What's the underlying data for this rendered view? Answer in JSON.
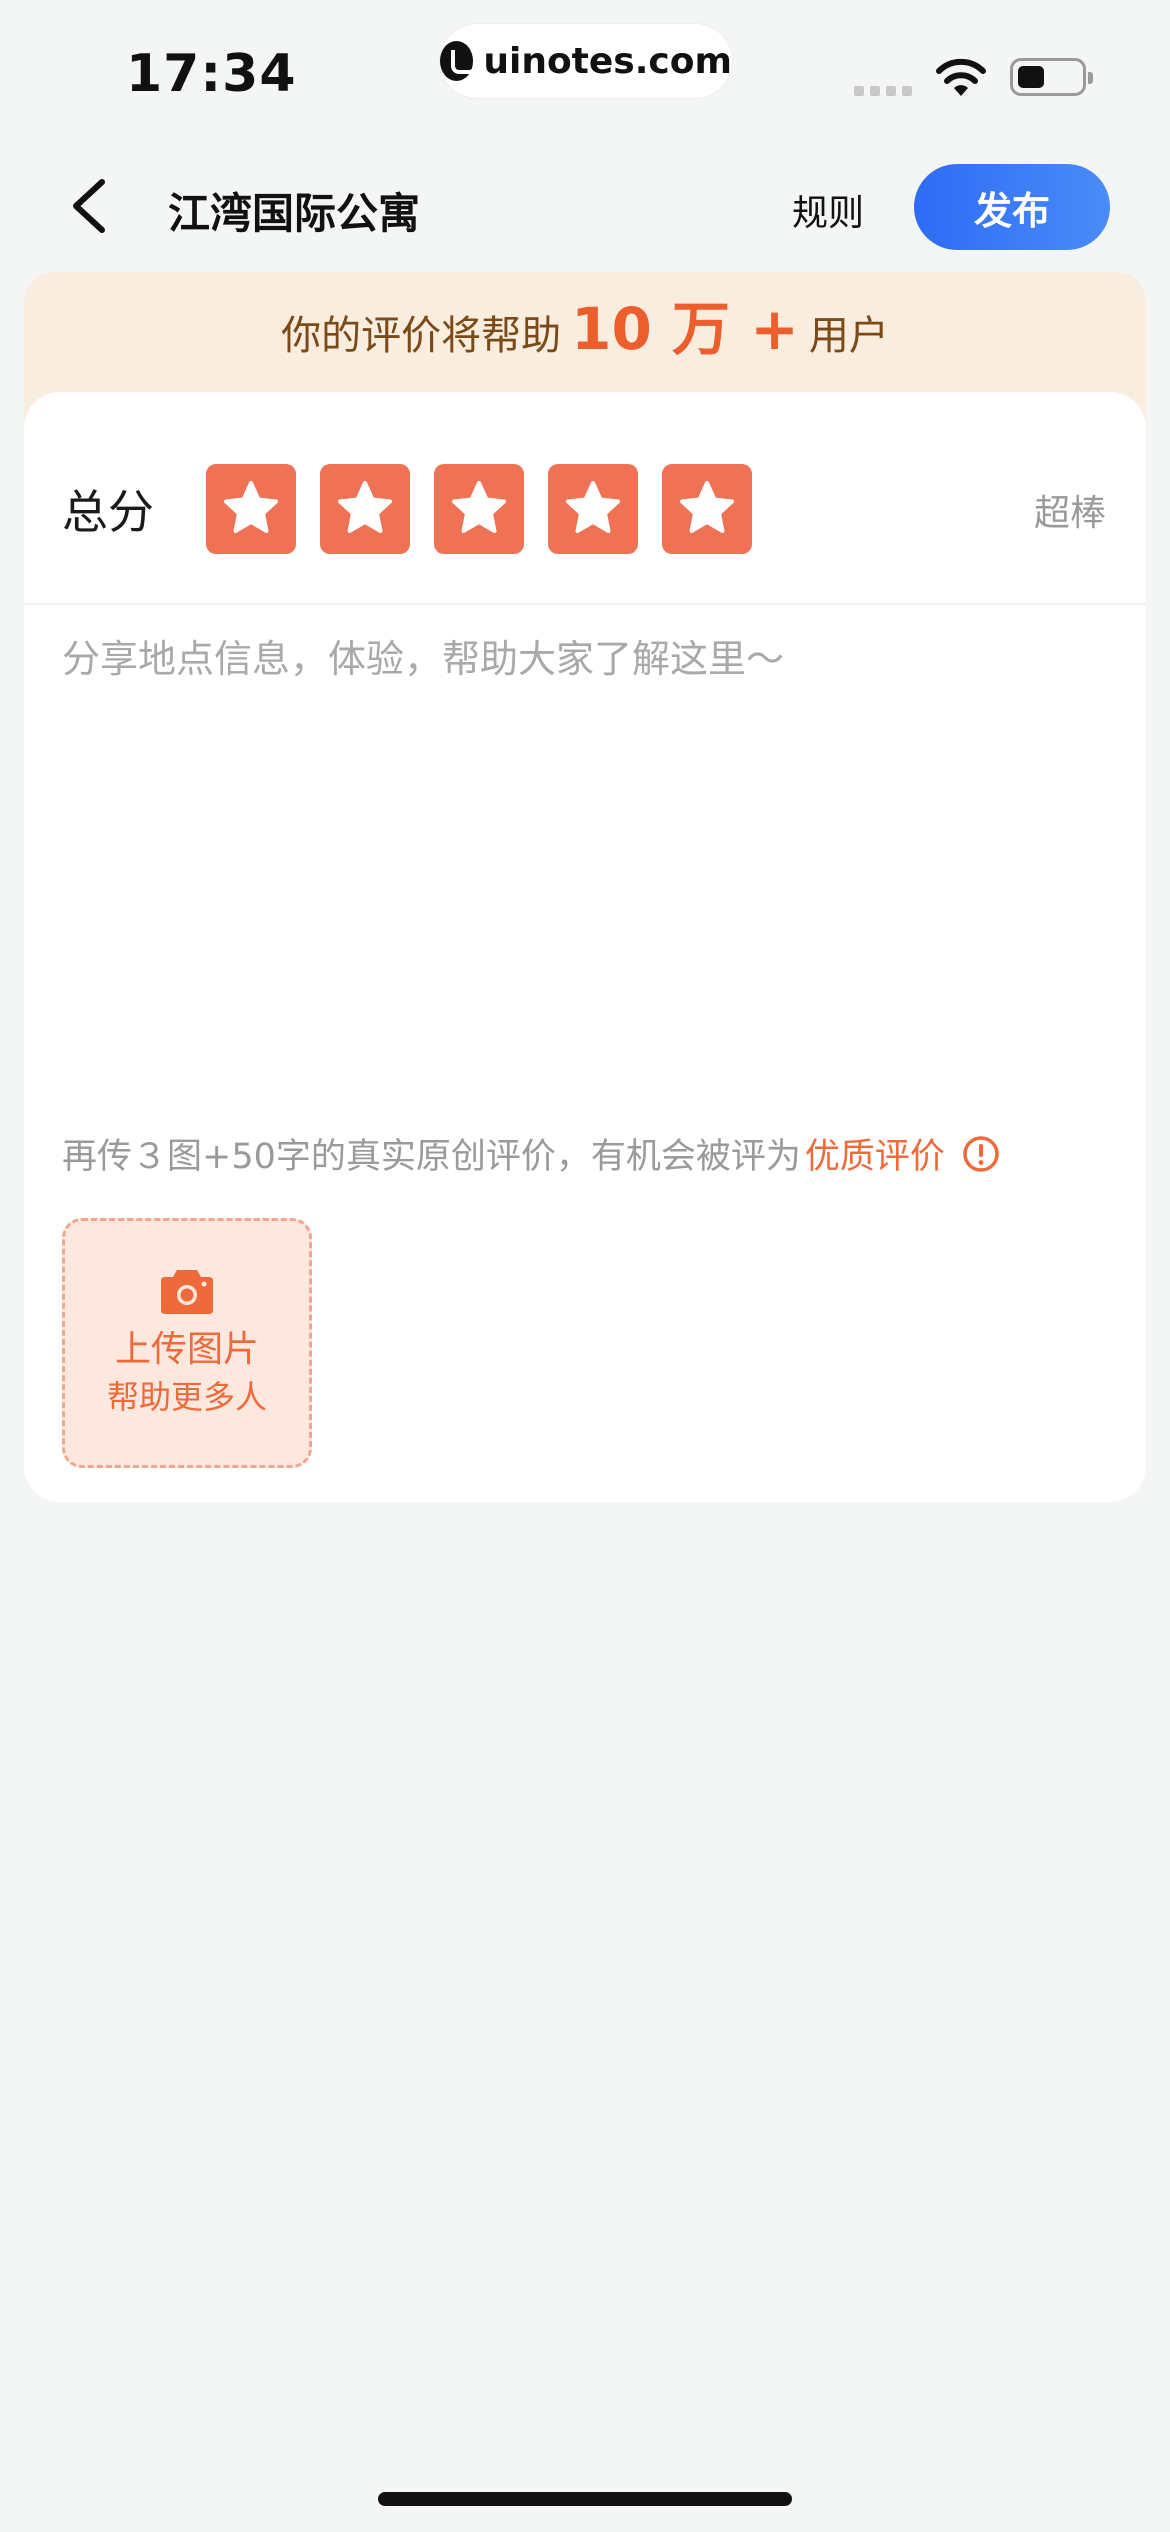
{
  "status_bar": {
    "time": "17:34",
    "url": "uinotes.com"
  },
  "nav": {
    "title": "江湾国际公寓",
    "rules_label": "规则",
    "publish_label": "发布"
  },
  "banner": {
    "prefix": "你的评价将帮助",
    "highlight": "10 万 +",
    "suffix": "用户"
  },
  "score": {
    "label": "总分",
    "rating": 5,
    "max": 5,
    "rating_text": "超棒",
    "star_color": "#ef7254"
  },
  "review": {
    "placeholder": "分享地点信息，体验，帮助大家了解这里～",
    "value": ""
  },
  "hint": {
    "text": "再传３图+50字的真实原创评价，有机会被评为",
    "highlight": "优质评价"
  },
  "upload": {
    "line1": "上传图片",
    "line2": "帮助更多人"
  },
  "icons": [
    "back-icon",
    "star-icon",
    "info-icon",
    "camera-icon",
    "wifi-icon",
    "battery-icon"
  ],
  "colors": {
    "accent": "#ef6a3a",
    "publish_button": "#2f6bf6",
    "banner_bg": "#f9eddf"
  }
}
